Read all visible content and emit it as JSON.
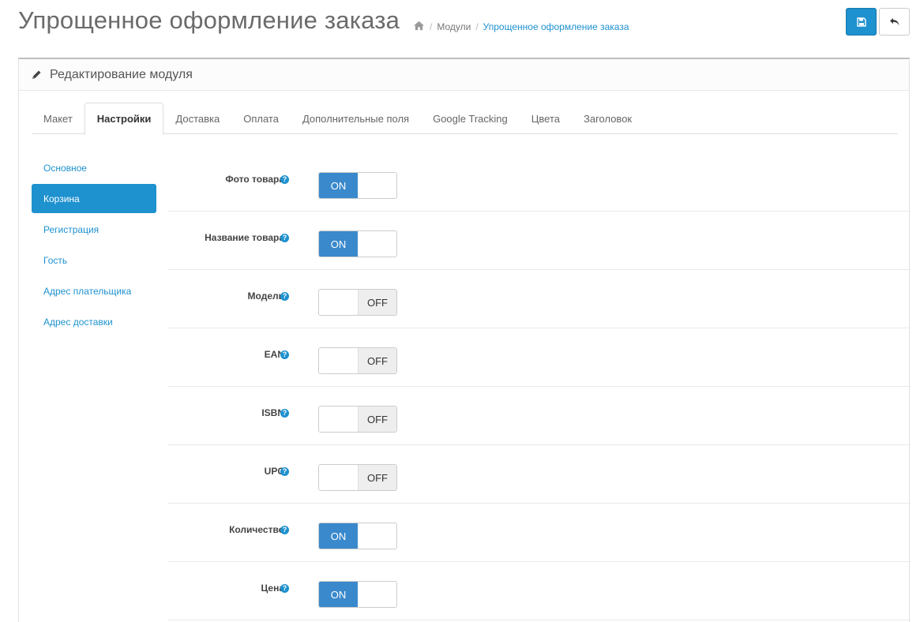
{
  "header": {
    "title": "Упрощенное оформление заказа",
    "breadcrumb": [
      {
        "label": "Модули",
        "link": false
      },
      {
        "label": "Упрощенное оформление заказа",
        "link": true
      }
    ],
    "save_icon": "floppy-disk-icon",
    "back_icon": "reply-arrow-icon"
  },
  "panel": {
    "title": "Редактирование модуля",
    "icon": "pencil-icon"
  },
  "tabs": [
    {
      "label": "Макет",
      "active": false
    },
    {
      "label": "Настройки",
      "active": true
    },
    {
      "label": "Доставка",
      "active": false
    },
    {
      "label": "Оплата",
      "active": false
    },
    {
      "label": "Дополнительные поля",
      "active": false
    },
    {
      "label": "Google Tracking",
      "active": false
    },
    {
      "label": "Цвета",
      "active": false
    },
    {
      "label": "Заголовок",
      "active": false
    }
  ],
  "side_nav": [
    {
      "label": "Основное",
      "active": false
    },
    {
      "label": "Корзина",
      "active": true
    },
    {
      "label": "Регистрация",
      "active": false
    },
    {
      "label": "Гость",
      "active": false
    },
    {
      "label": "Адрес плательщика",
      "active": false
    },
    {
      "label": "Адрес доставки",
      "active": false
    }
  ],
  "settings": [
    {
      "label": "Фото товара",
      "state": "ON"
    },
    {
      "label": "Название товара",
      "state": "ON"
    },
    {
      "label": "Модель",
      "state": "OFF"
    },
    {
      "label": "EAN",
      "state": "OFF"
    },
    {
      "label": "ISBN",
      "state": "OFF"
    },
    {
      "label": "UPC",
      "state": "OFF"
    },
    {
      "label": "Количество",
      "state": "ON"
    },
    {
      "label": "Цена",
      "state": "ON"
    }
  ],
  "help_glyph": "?",
  "colors": {
    "accent": "#1e91cf",
    "toggle_on": "#3a89cc",
    "toggle_off": "#eeeeee"
  }
}
